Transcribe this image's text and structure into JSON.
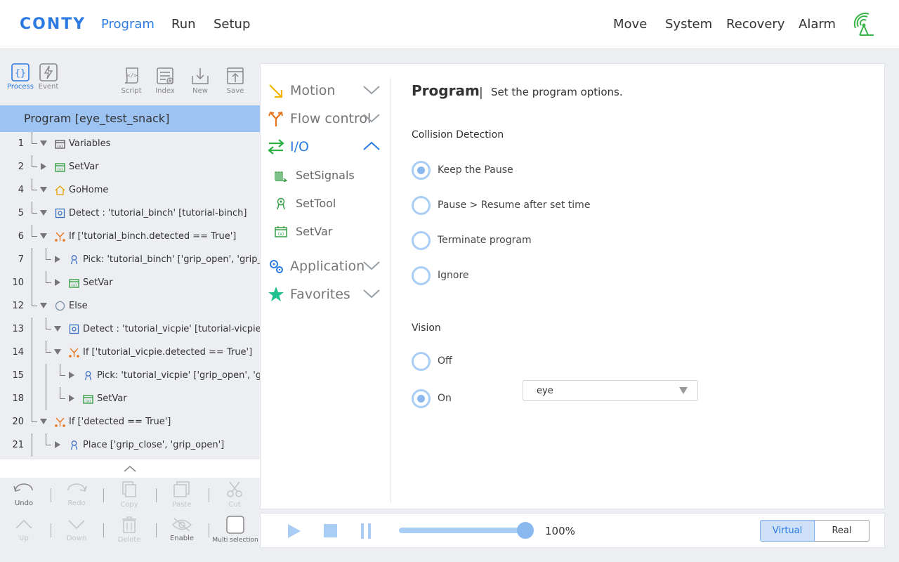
{
  "app": {
    "logo": "CONTY",
    "nav_left": [
      "Program",
      "Run",
      "Setup"
    ],
    "nav_right": [
      "Move",
      "System",
      "Recovery",
      "Alarm"
    ],
    "active_nav": "Program",
    "connection_icon": "signal-icon",
    "accent_color": "#2d7be0"
  },
  "toolbar": {
    "process": "Process",
    "event": "Event",
    "script": "Script",
    "index": "Index",
    "new": "New",
    "save": "Save"
  },
  "program": {
    "header": "Program [eye_test_snack]",
    "rows": [
      {
        "num": "1",
        "label": "Variables",
        "icon": "variables-icon"
      },
      {
        "num": "2",
        "label": "SetVar",
        "icon": "setvar-icon"
      },
      {
        "num": "4",
        "label": "GoHome",
        "icon": "home-icon"
      },
      {
        "num": "5",
        "label": "Detect : 'tutorial_binch' [tutorial-binch]",
        "icon": "detect-icon"
      },
      {
        "num": "6",
        "label": "If ['tutorial_binch.detected == True']",
        "icon": "branch-icon"
      },
      {
        "num": "7",
        "label": "Pick: 'tutorial_binch' ['grip_open', 'grip_close']",
        "icon": "pick-icon"
      },
      {
        "num": "10",
        "label": "SetVar",
        "icon": "setvar-icon"
      },
      {
        "num": "12",
        "label": "Else",
        "icon": "else-icon"
      },
      {
        "num": "13",
        "label": "Detect : 'tutorial_vicpie' [tutorial-vicpie]",
        "icon": "detect-icon"
      },
      {
        "num": "14",
        "label": "If ['tutorial_vicpie.detected == True']",
        "icon": "branch-icon"
      },
      {
        "num": "15",
        "label": "Pick: 'tutorial_vicpie' ['grip_open', 'grip_close']",
        "icon": "pick-icon"
      },
      {
        "num": "18",
        "label": "SetVar",
        "icon": "setvar-icon"
      },
      {
        "num": "20",
        "label": "If ['detected == True']",
        "icon": "branch-icon"
      },
      {
        "num": "21",
        "label": "Place ['grip_close', 'grip_open']",
        "icon": "place-icon"
      }
    ]
  },
  "edit_actions": {
    "undo": "Undo",
    "redo": "Redo",
    "copy": "Copy",
    "paste": "Paste",
    "cut": "Cut",
    "up": "Up",
    "down": "Down",
    "delete": "Delete",
    "enable": "Enable",
    "multi_selection": "Multi selection"
  },
  "commands": {
    "motion": "Motion",
    "flow_control": "Flow control",
    "io": "I/O",
    "io_items": [
      "SetSignals",
      "SetTool",
      "SetVar"
    ],
    "application": "Application",
    "favorites": "Favorites"
  },
  "options": {
    "title": "Program",
    "separator": "|",
    "description": "Set the program options.",
    "collision": {
      "title": "Collision Detection",
      "options": [
        "Keep the Pause",
        "Pause > Resume after set time",
        "Terminate program",
        "Ignore"
      ],
      "selected": "Keep the Pause"
    },
    "vision": {
      "title": "Vision",
      "off_label": "Off",
      "on_label": "On",
      "selected": "On",
      "model_value": "eye"
    }
  },
  "player": {
    "speed_text": "100%",
    "speed_fraction": 1.0,
    "mode_virtual": "Virtual",
    "mode_real": "Real",
    "active_mode": "Virtual"
  }
}
